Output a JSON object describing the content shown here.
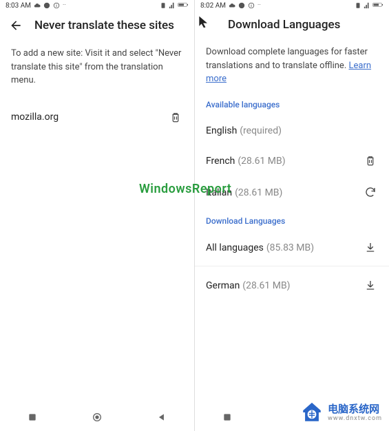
{
  "left": {
    "status": {
      "time": "8:03 AM"
    },
    "header": {
      "title": "Never translate these sites"
    },
    "description": "To add a new site: Visit it and select \"Never translate this site\" from the translation menu.",
    "sites": [
      {
        "name": "mozilla.org"
      }
    ]
  },
  "right": {
    "status": {
      "time": "8:02 AM"
    },
    "header": {
      "title": "Download Languages"
    },
    "description": "Download complete languages for faster translations and to translate offline. ",
    "learn_more": "Learn more",
    "sections": {
      "available": "Available languages",
      "download": "Download Languages"
    },
    "available": [
      {
        "name": "English",
        "meta": "(required)",
        "action": "none"
      },
      {
        "name": "French",
        "meta": "(28.61 MB)",
        "action": "delete"
      },
      {
        "name": "Italian",
        "meta": "(28.61 MB)",
        "action": "refresh"
      }
    ],
    "downloadable": [
      {
        "name": "All languages",
        "meta": "(85.83 MB)",
        "action": "download"
      },
      {
        "name": "German",
        "meta": "(28.61 MB)",
        "action": "download"
      }
    ]
  },
  "watermark": "WindowsReport",
  "footer": {
    "cn": "电脑系统网",
    "url": "www.dnxtw.com"
  }
}
